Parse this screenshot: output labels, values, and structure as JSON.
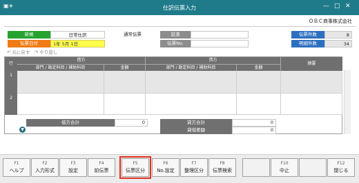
{
  "app": {
    "title": "仕訳伝票入力",
    "logo_icon": "app-plus-logo",
    "company": "ＯＢＣ商事株式会社"
  },
  "header": {
    "mode_label": "新規",
    "entry_type": "日常仕訳",
    "voucher_type": "通常伝票",
    "date_label": "伝票日付",
    "date_era": "1",
    "date_year": "年",
    "date_month": "5月",
    "date_day": "1日",
    "evidence_label": "証憑",
    "evidence_value": "",
    "voucher_no_label": "伝票No.",
    "voucher_no_value": "",
    "voucher_count_label": "伝票件数",
    "voucher_count_value": "8",
    "detail_count_label": "明細件数",
    "detail_count_value": "34"
  },
  "toolbar": {
    "undo": "元に戻す",
    "redo": "やり直し"
  },
  "grid": {
    "row_header": "行",
    "debit_header": "借方",
    "credit_header": "貸方",
    "summary_header": "摘要",
    "dept_account_header": "部門 / 勘定科目 / 補助科目",
    "amount_header": "金額",
    "rows": [
      "1",
      "2"
    ]
  },
  "totals": {
    "debit_total_label": "借方合計",
    "debit_total_value": "0",
    "credit_total_label": "貸方合計",
    "credit_total_value": "0",
    "difference_label": "貸借差額",
    "difference_value": "0"
  },
  "function_keys": [
    {
      "key": "F1",
      "label": "ヘルプ"
    },
    {
      "key": "F2",
      "label": "入力形式"
    },
    {
      "key": "F3",
      "label": "設定"
    },
    {
      "key": "F4",
      "label": "前伝票"
    },
    {
      "key": "F5",
      "label": "伝票区分"
    },
    {
      "key": "F6",
      "label": "No.設定"
    },
    {
      "key": "F7",
      "label": "整理区分"
    },
    {
      "key": "F8",
      "label": "伝票検索"
    },
    {
      "key": "",
      "label": ""
    },
    {
      "key": "F10",
      "label": "中止"
    },
    {
      "key": "",
      "label": ""
    },
    {
      "key": "F12",
      "label": "閉じる"
    }
  ],
  "colors": {
    "titlebar": "#1f7b8a",
    "new_label": "#26a32f",
    "date_label": "#f07b16",
    "count_label": "#2d6fbf",
    "highlight": "#e32e1e"
  }
}
